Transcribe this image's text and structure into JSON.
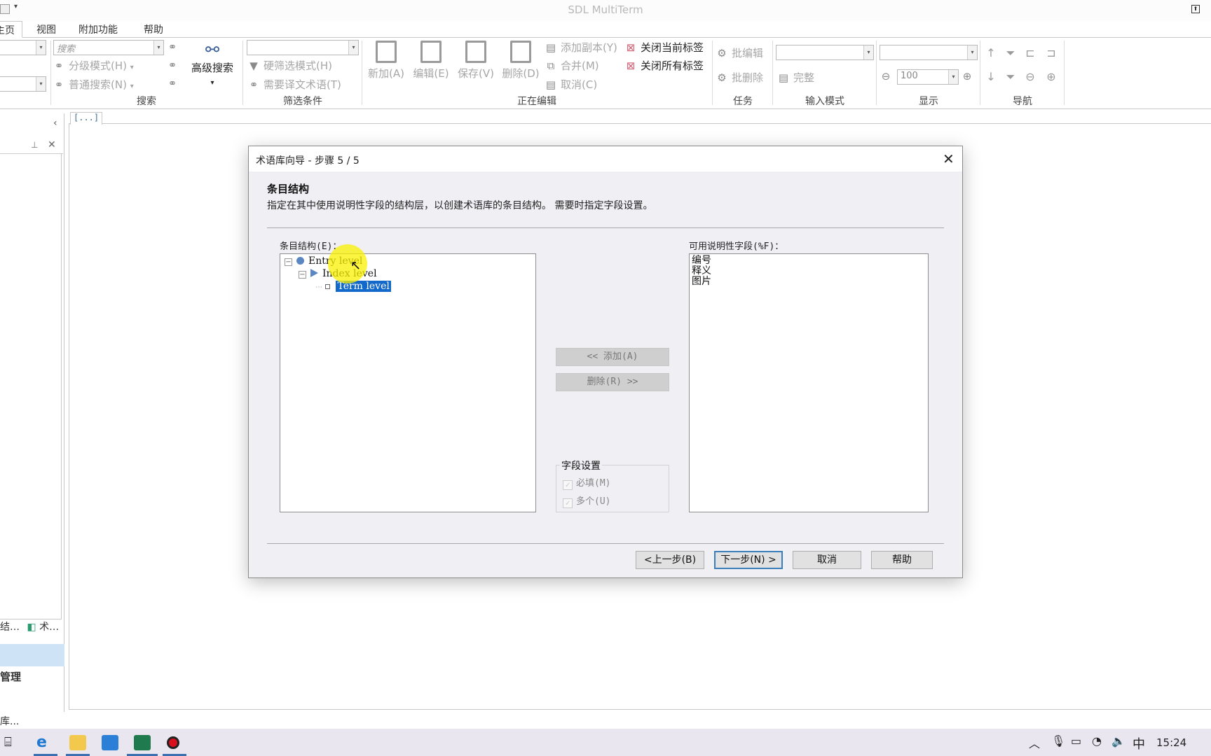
{
  "app": {
    "title": "SDL MultiTerm",
    "qat_caret": "▾",
    "restore_icon": "⬆"
  },
  "tabs": [
    {
      "label": "主页",
      "visible_label": "主页",
      "active": true
    },
    {
      "label": "视图",
      "active": false
    },
    {
      "label": "附加功能",
      "active": false
    },
    {
      "label": "帮助",
      "active": false
    }
  ],
  "ribbon": {
    "groups": {
      "search": "搜索",
      "filter": "筛选条件",
      "editing": "正在编辑",
      "tasks": "任务",
      "input_mode": "输入模式",
      "display": "显示",
      "navigation": "导航"
    },
    "search": {
      "search_placeholder": "搜索",
      "fuzzy_mode": "分级模式(H)",
      "normal_search": "普通搜索(N)",
      "advanced_search": "高级搜索",
      "dropdown_caret": "▾"
    },
    "filter": {
      "hard_filter": "硬筛选模式(H)",
      "target_required": "需要译文术语(T)"
    },
    "editing": {
      "new": "新加(A)",
      "edit": "编辑(E)",
      "save": "保存(V)",
      "delete": "删除(D)",
      "add_copy": "添加副本(Y)",
      "merge": "合并(M)",
      "cancel": "取消(C)",
      "close_current_tab": "关闭当前标签",
      "close_all_tabs": "关闭所有标签"
    },
    "tasks": {
      "batch_edit": "批编辑",
      "batch_delete": "批删除"
    },
    "input_mode": {
      "complete": "完整"
    },
    "display": {
      "zoom_value": "100"
    }
  },
  "left_pane": {
    "collapse": "‹",
    "pin": "⊥",
    "close": "✕",
    "tab1": "结…",
    "tab2": "术…",
    "item": "管理"
  },
  "doc_tab": {
    "label": "[...]"
  },
  "status_bar": {
    "text": "库..."
  },
  "dialog": {
    "title": "术语库向导 - 步骤 5 / 5",
    "close": "✕",
    "heading": "条目结构",
    "description": "指定在其中使用说明性字段的结构层，以创建术语库的条目结构。 需要时指定字段设置。",
    "tree_label": "条目结构(E)：",
    "tree": [
      {
        "label": "Entry level",
        "expander": "−",
        "icon": "circle",
        "selected": false
      },
      {
        "label": "Index level",
        "expander": "−",
        "icon": "triangle",
        "selected": false
      },
      {
        "label": "Term level",
        "expander": "",
        "icon": "square",
        "selected": true
      }
    ],
    "add_button": "<<  添加(A)",
    "remove_button": "删除(R)  >>",
    "field_settings": {
      "legend": "字段设置",
      "mandatory": {
        "label": "必填(M)",
        "checked": true,
        "enabled": false
      },
      "multiple": {
        "label": "多个(U)",
        "checked": true,
        "enabled": false
      }
    },
    "fields_label": "可用说明性字段(%F)：",
    "fields": [
      "编号",
      "释义",
      "图片"
    ],
    "buttons": {
      "back": "<上一步(B)",
      "next": "下一步(N) >",
      "cancel": "取消",
      "help": "帮助"
    }
  },
  "taskbar": {
    "apps": [
      "task-view",
      "edge",
      "file-explorer",
      "mail",
      "multiterm",
      "recorder"
    ],
    "tray": {
      "chevron": "︿",
      "ime": "中",
      "time": "15:24"
    }
  }
}
